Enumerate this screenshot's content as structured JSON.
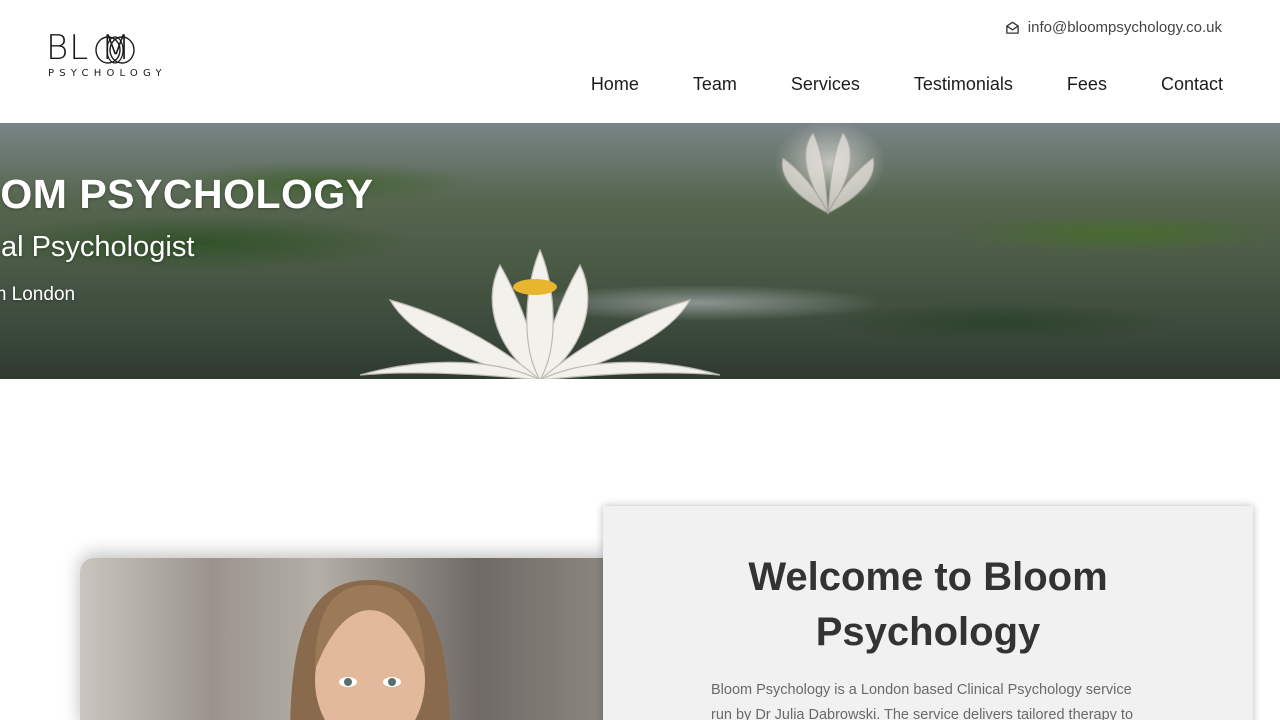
{
  "header": {
    "logo_word": "BL  M",
    "logo_sub": "PSYCHOLOGY",
    "email": "info@bloompsychology.co.uk",
    "email_icon": "envelope-open-icon",
    "nav": [
      "Home",
      "Team",
      "Services",
      "Testimonials",
      "Fees",
      "Contact"
    ]
  },
  "hero": {
    "title": "OOM PSYCHOLOGY",
    "subtitle": "ical Psychologist",
    "location": "am London"
  },
  "welcome": {
    "title_line1": "Welcome to Bloom",
    "title_line2": "Psychology",
    "body": "Bloom Psychology is a London based Clinical Psychology service run by Dr Julia Dabrowski. The service delivers tailored therapy to"
  },
  "colors": {
    "card_bg": "#f1f1f1",
    "nav_text": "#1c1c1c",
    "body_text": "#6a6a6a"
  }
}
